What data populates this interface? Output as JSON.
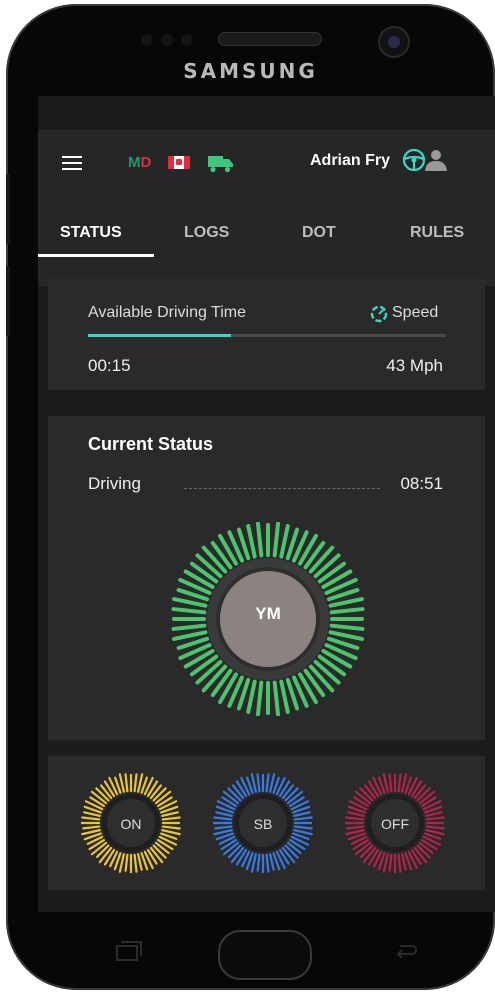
{
  "device": {
    "brand": "SAMSUNG"
  },
  "header": {
    "md": {
      "m": "M",
      "d": "D"
    },
    "user_name": "Adrian Fry",
    "menu_icon": "hamburger-icon",
    "flag_icon": "canada-flag-icon",
    "truck_icon": "truck-icon",
    "wheel_icon": "steering-wheel-icon",
    "person_icon": "user-icon"
  },
  "tabs": [
    {
      "label": "STATUS",
      "active": true
    },
    {
      "label": "LOGS",
      "active": false
    },
    {
      "label": "DOT",
      "active": false
    },
    {
      "label": "RULES",
      "active": false
    }
  ],
  "driving_card": {
    "available_label": "Available Driving Time",
    "speed_label": "Speed",
    "time_value": "00:15",
    "speed_value": "43 Mph",
    "progress_fraction": 0.4,
    "accent": "#3fd6c3"
  },
  "status_card": {
    "title": "Current Status",
    "status": "Driving",
    "time": "08:51",
    "dial_label": "YM",
    "dial_color": "#4cc46d"
  },
  "status_buttons": [
    {
      "label": "ON",
      "color": "#e9c53a"
    },
    {
      "label": "SB",
      "color": "#3a7ae0"
    },
    {
      "label": "OFF",
      "color": "#b0244c"
    }
  ],
  "nav": {
    "recent_icon": "recent-apps-icon",
    "home_icon": "home-button-icon",
    "back_icon": "back-icon"
  }
}
